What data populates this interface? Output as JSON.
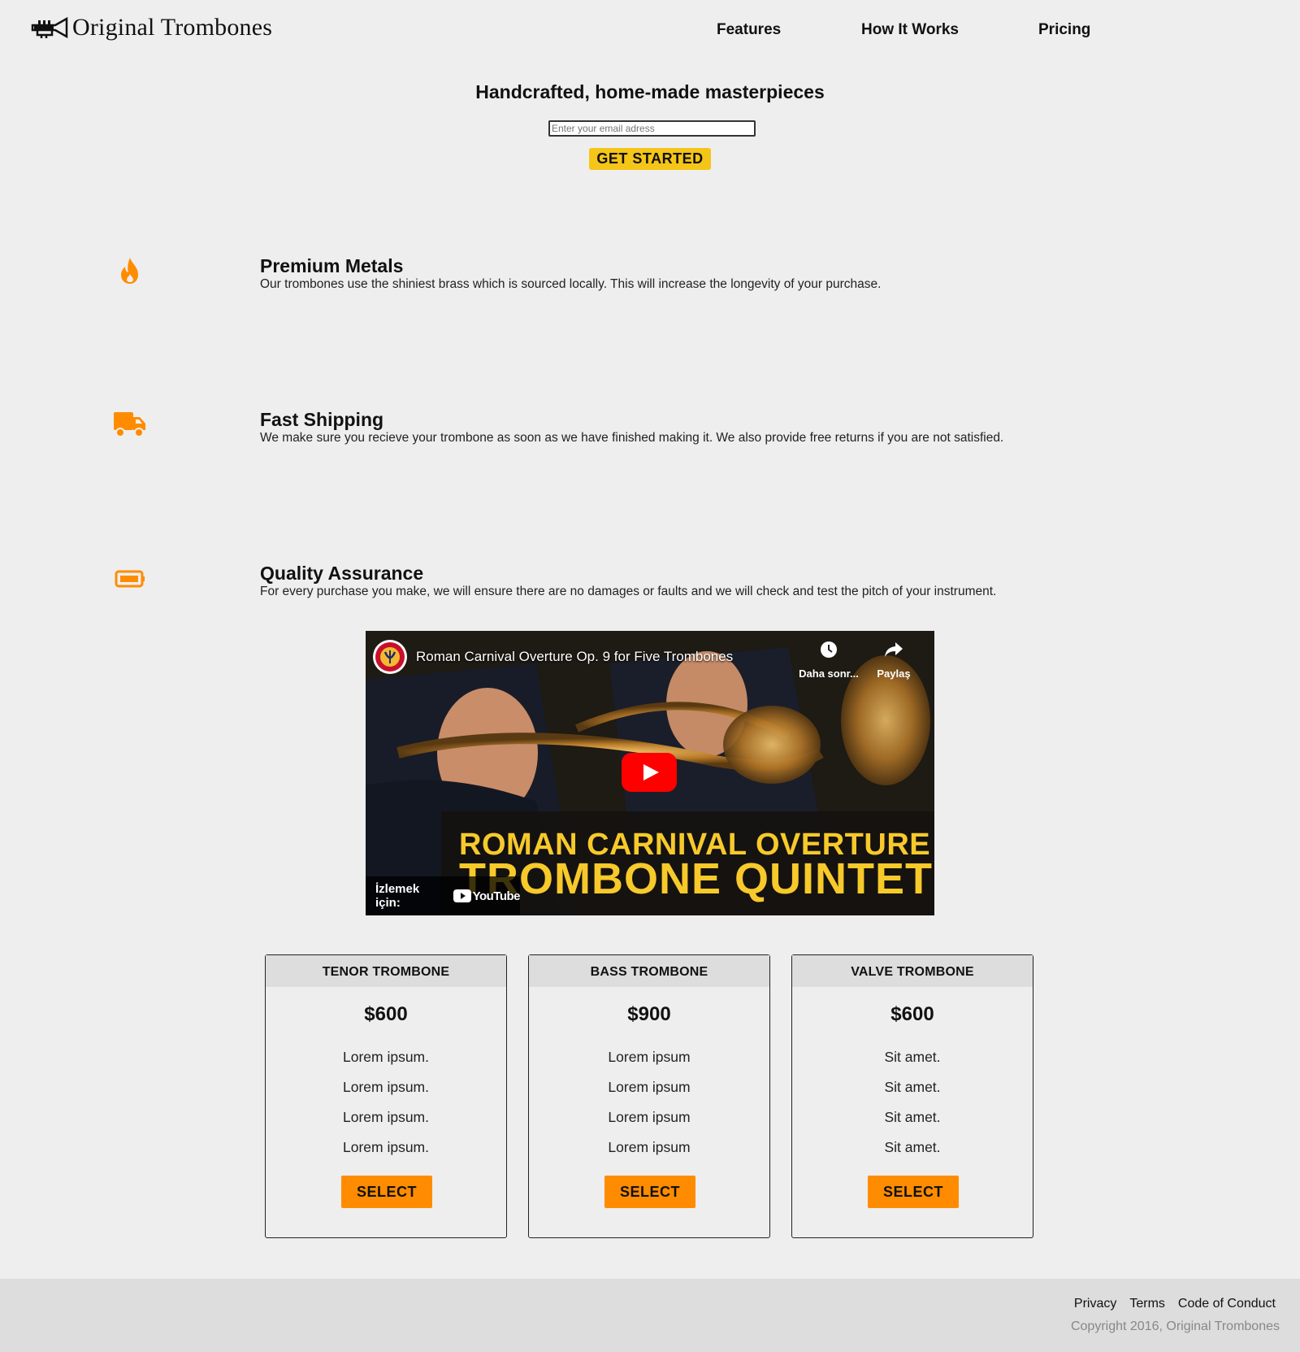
{
  "brand": {
    "name": "Original Trombones",
    "icon": "trumpet-icon"
  },
  "nav": {
    "items": [
      {
        "label": "Features"
      },
      {
        "label": "How It Works"
      },
      {
        "label": "Pricing"
      }
    ]
  },
  "hero": {
    "title": "Handcrafted, home-made masterpieces",
    "email_placeholder": "Enter your email adress",
    "cta_label": "GET STARTED",
    "cta_color": "#f5c518"
  },
  "features": [
    {
      "icon": "fire-icon",
      "title": "Premium Metals",
      "description": "Our trombones use the shiniest brass which is sourced locally. This will increase the longevity of your purchase."
    },
    {
      "icon": "truck-icon",
      "title": "Fast Shipping",
      "description": "We make sure you recieve your trombone as soon as we have finished making it. We also provide free returns if you are not satisfied."
    },
    {
      "icon": "battery-icon",
      "title": "Quality Assurance",
      "description": "For every purchase you make, we will ensure there are no damages or faults and we will check and test the pitch of your instrument."
    }
  ],
  "video": {
    "title": "Roman Carnival Overture Op. 9 for Five Trombones",
    "watch_later_label": "Daha sonr...",
    "share_label": "Paylaş",
    "banner_line1": "ROMAN CARNIVAL OVERTURE",
    "banner_line2": "TROMBONE QUINTET",
    "watch_on_label": "İzlemek için:",
    "youtube_label": "YouTube"
  },
  "pricing": [
    {
      "name": "TENOR TROMBONE",
      "price": "$600",
      "features": [
        "Lorem ipsum.",
        "Lorem ipsum.",
        "Lorem ipsum.",
        "Lorem ipsum."
      ],
      "button_label": "SELECT"
    },
    {
      "name": "BASS TROMBONE",
      "price": "$900",
      "features": [
        "Lorem ipsum",
        "Lorem ipsum",
        "Lorem ipsum",
        "Lorem ipsum"
      ],
      "button_label": "SELECT"
    },
    {
      "name": "VALVE TROMBONE",
      "price": "$600",
      "features": [
        "Sit amet.",
        "Sit amet.",
        "Sit amet.",
        "Sit amet."
      ],
      "button_label": "SELECT"
    }
  ],
  "footer": {
    "links": [
      {
        "label": "Privacy"
      },
      {
        "label": "Terms"
      },
      {
        "label": "Code of Conduct"
      }
    ],
    "copyright": "Copyright 2016, Original Trombones"
  },
  "colors": {
    "accent": "#ff8c00",
    "cta_yellow": "#f5c518",
    "background": "#eeeeee",
    "footer_bg": "#dddddd",
    "card_header_bg": "#dddddd",
    "youtube_red": "#ff0000",
    "banner_text": "#f7c92a"
  }
}
